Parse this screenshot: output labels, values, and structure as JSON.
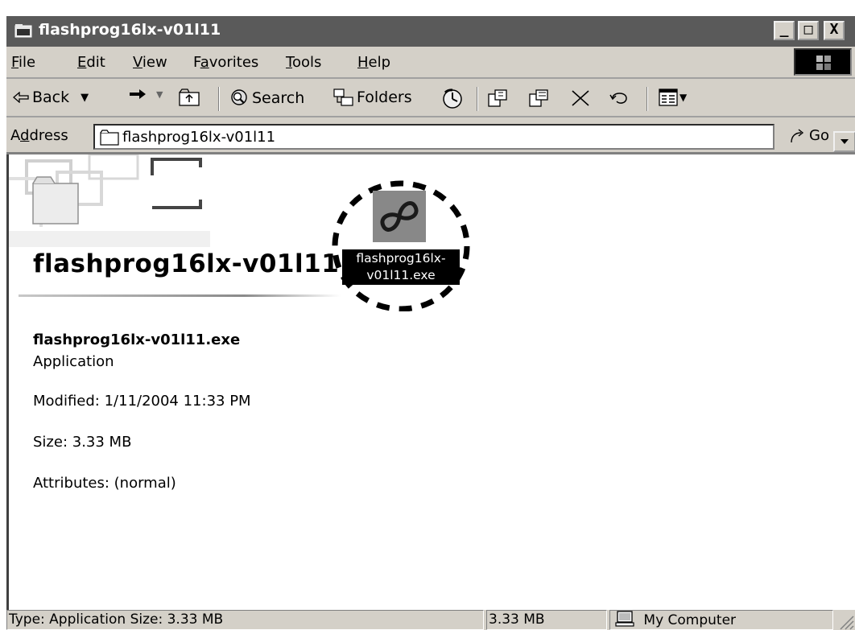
{
  "window": {
    "title": "flashprog16lx-v01l11",
    "buttons": {
      "minimize": "_",
      "maximize": "□",
      "close": "X"
    }
  },
  "menu": {
    "items": [
      {
        "label": "File",
        "key": "F",
        "rest": "ile"
      },
      {
        "label": "Edit",
        "key": "E",
        "rest": "dit"
      },
      {
        "label": "View",
        "key": "V",
        "rest": "iew"
      },
      {
        "label": "Favorites",
        "pre": "F",
        "key": "a",
        "rest": "vorites"
      },
      {
        "label": "Tools",
        "key": "T",
        "rest": "ools"
      },
      {
        "label": "Help",
        "key": "H",
        "rest": "elp"
      }
    ]
  },
  "toolbar": {
    "back_label": "Back",
    "search_label": "Search",
    "folders_label": "Folders"
  },
  "address": {
    "label_pre": "A",
    "label_key": "d",
    "label_rest": "dress",
    "value": "flashprog16lx-v01l11",
    "go_label": "Go"
  },
  "content": {
    "folder_heading": "flashprog16lx-v01l11",
    "file_icon_label_line1": "flashprog16lx-",
    "file_icon_label_line2": "v01l11.exe",
    "details": {
      "name": "flashprog16lx-v01l11.exe",
      "type": "Application",
      "modified": "Modified: 1/11/2004 11:33 PM",
      "size": "Size: 3.33 MB",
      "attributes": "Attributes: (normal)"
    }
  },
  "statusbar": {
    "info": "Type: Application Size: 3.33 MB",
    "size": "3.33 MB",
    "zone": "My Computer"
  }
}
